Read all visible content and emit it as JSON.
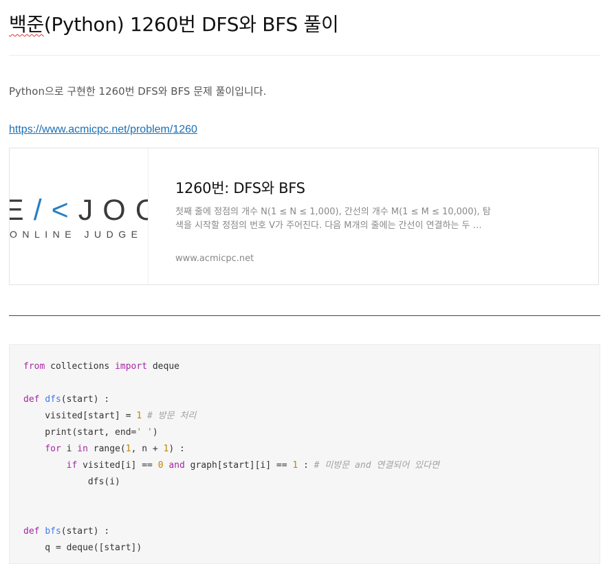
{
  "post": {
    "title_prefix": "백준",
    "title_rest": "(Python) 1260번 DFS와 BFS 풀이",
    "intro": "Python으로 구현한 1260번 DFS와 BFS 문제 풀이입니다.",
    "link": "https://www.acmicpc.net/problem/1260"
  },
  "card": {
    "logo_top_pre": "E",
    "logo_top_k": "/<",
    "logo_top_post": "JOC",
    "logo_bottom": "ONLINE JUDGE",
    "title": "1260번: DFS와 BFS",
    "description": "첫째 줄에 정점의 개수 N(1 ≤ N ≤ 1,000), 간선의 개수 M(1 ≤ M ≤ 10,000), 탐색을 시작할 정점의 번호 V가 주어진다. 다음 M개의 줄에는 간선이 연결하는 두 …",
    "host": "www.acmicpc.net"
  },
  "code": {
    "l1_kw1": "from",
    "l1_mod": " collections ",
    "l1_kw2": "import",
    "l1_name": " deque",
    "l2_kw": "def",
    "l2_fn": "dfs",
    "l2_rest": "(start) :",
    "l3_a": "    visited[start] = ",
    "l3_num": "1",
    "l3_cm": " # 방문 처리",
    "l4_a": "    print(start, end=",
    "l4_str": "' '",
    "l4_b": ")",
    "l5_kw1": "for",
    "l5_a": " i ",
    "l5_kw2": "in",
    "l5_b": " range(",
    "l5_n1": "1",
    "l5_c": ", n + ",
    "l5_n2": "1",
    "l5_d": ") :",
    "l6_kw1": "if",
    "l6_a": " visited[i] == ",
    "l6_n1": "0",
    "l6_kw2": " and",
    "l6_b": " graph[start][i] == ",
    "l6_n2": "1",
    "l6_c": " :",
    "l6_cm": " # 미방문 and 연결되어 있다면",
    "l7": "            dfs(i)",
    "l8_kw": "def",
    "l8_fn": "bfs",
    "l8_rest": "(start) :",
    "l9": "    q = deque([start])"
  }
}
